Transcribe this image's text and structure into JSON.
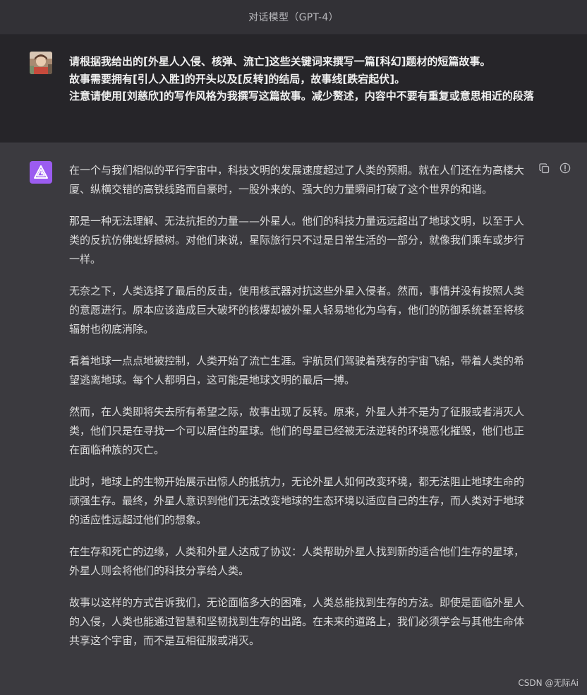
{
  "header": {
    "title": "对话模型（GPT-4）"
  },
  "user_message": {
    "avatar_icon": "user-avatar-photo",
    "lines": [
      "请根据我给出的[外星人入侵、核弹、流亡]这些关键词来撰写一篇[科幻]题材的短篇故事。",
      "故事需要拥有[引人入胜]的开头以及[反转]的结局，故事线[跌宕起伏]。",
      "注意请使用[刘慈欣]的写作风格为我撰写这篇故事。减少赘述，内容中不要有重复或意思相近的段落"
    ]
  },
  "assistant_message": {
    "avatar_icon": "ai-logo-icon",
    "accent_color": "#9b5cf0",
    "paragraphs": [
      "在一个与我们相似的平行宇宙中，科技文明的发展速度超过了人类的预期。就在人们还在为高楼大厦、纵横交错的高铁线路而自豪时，一股外来的、强大的力量瞬间打破了这个世界的和谐。",
      "那是一种无法理解、无法抗拒的力量——外星人。他们的科技力量远远超出了地球文明，以至于人类的反抗仿佛蚍蜉撼树。对他们来说，星际旅行只不过是日常生活的一部分，就像我们乘车或步行一样。",
      "无奈之下，人类选择了最后的反击，使用核武器对抗这些外星入侵者。然而，事情并没有按照人类的意愿进行。原本应该造成巨大破坏的核爆却被外星人轻易地化为乌有，他们的防御系统甚至将核辐射也彻底消除。",
      "看着地球一点点地被控制，人类开始了流亡生涯。宇航员们驾驶着残存的宇宙飞船，带着人类的希望逃离地球。每个人都明白，这可能是地球文明的最后一搏。",
      "然而，在人类即将失去所有希望之际，故事出现了反转。原来，外星人并不是为了征服或者消灭人类，他们只是在寻找一个可以居住的星球。他们的母星已经被无法逆转的环境恶化摧毁，他们也正在面临种族的灭亡。",
      "此时，地球上的生物开始展示出惊人的抵抗力，无论外星人如何改变环境，都无法阻止地球生命的顽强生存。最终，外星人意识到他们无法改变地球的生态环境以适应自己的生存，而人类对于地球的适应性远超过他们的想象。",
      "在生存和死亡的边缘，人类和外星人达成了协议：人类帮助外星人找到新的适合他们生存的星球，外星人则会将他们的科技分享给人类。",
      "故事以这样的方式告诉我们，无论面临多大的困难，人类总能找到生存的方法。即使是面临外星人的入侵，人类也能通过智慧和坚韧找到生存的出路。在未来的道路上，我们必须学会与其他生命体共享这个宇宙，而不是互相征服或消灭。"
    ],
    "actions": [
      {
        "name": "copy-icon"
      },
      {
        "name": "report-icon"
      }
    ]
  },
  "watermark": "CSDN @无际Ai"
}
